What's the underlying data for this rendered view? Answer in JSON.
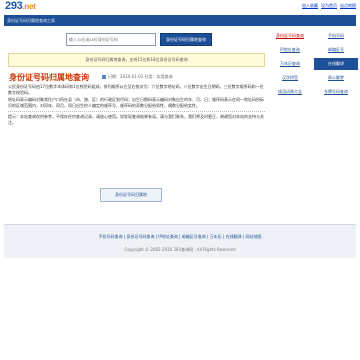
{
  "header": {
    "logo_main": "293",
    "logo_suffix": ".net",
    "links": [
      "加入收藏",
      "设为首页",
      "站点地图"
    ]
  },
  "bluebar": {
    "text": "身份证号码归属地查询工具"
  },
  "search": {
    "placeholder": "输入15位或18位身份证号码",
    "button": "身份证号码归属地查询"
  },
  "notice": "身份证号码归属地查询，支持15位和18位身份证号码查询",
  "article": {
    "title": "身份证号码归属地查询",
    "meta": "日期：2010-01-01  分类：实用查询",
    "paragraphs": [
      "公民身份证号码由17位数字本体码和1位校验码组成，排列顺序从左至右依次为：六位数字地址码，八位数字出生日期码，三位数字顺序码和一位数字校验码。",
      "地址码表示编码对象常住户口所在县（市、旗、区）的行政区划代码；出生日期码表示编码对象出生的年、月、日；顺序码表示在同一地址码所标识的区域范围内，对同年、同月、同日出生的人编定的顺序号，顺序码的奇数分配给男性，偶数分配给女性。",
      "提示：本站查询仅供参考，不保存任何查询记录，请放心使用。如发现查询结果有误，请与我们联系，我们将及时更正，谢谢您对本站的支持与关注。"
    ],
    "submit_label": "身份证号码归属地"
  },
  "sidebar": {
    "items": [
      {
        "label": "身份证号码查询",
        "style": "red"
      },
      {
        "label": "手机号码",
        "style": "normal"
      },
      {
        "label": "IP地址查询",
        "style": "normal"
      },
      {
        "label": "邮编区号",
        "style": "normal"
      },
      {
        "label": "万年历查询",
        "style": "normal"
      },
      {
        "label": "在线翻译",
        "style": "active"
      },
      {
        "label": "汉字拼音",
        "style": "normal"
      },
      {
        "label": "周公解梦",
        "style": "normal"
      },
      {
        "label": "成语词典大全",
        "style": "normal"
      },
      {
        "label": "车牌号码查询",
        "style": "normal"
      }
    ]
  },
  "footer": {
    "links": "手机号码查询 | 身份证号码查询 | IP地址查询 | 邮编区号查询 | 万年历 | 在线翻译 | 网站地图",
    "copyright": "Copyright © 2002-2010  293查询网 . All Rights Reserved"
  },
  "colors": {
    "brand": "#1d4f96",
    "accent": "#cc3300",
    "notice_bg": "#fffbd9"
  }
}
